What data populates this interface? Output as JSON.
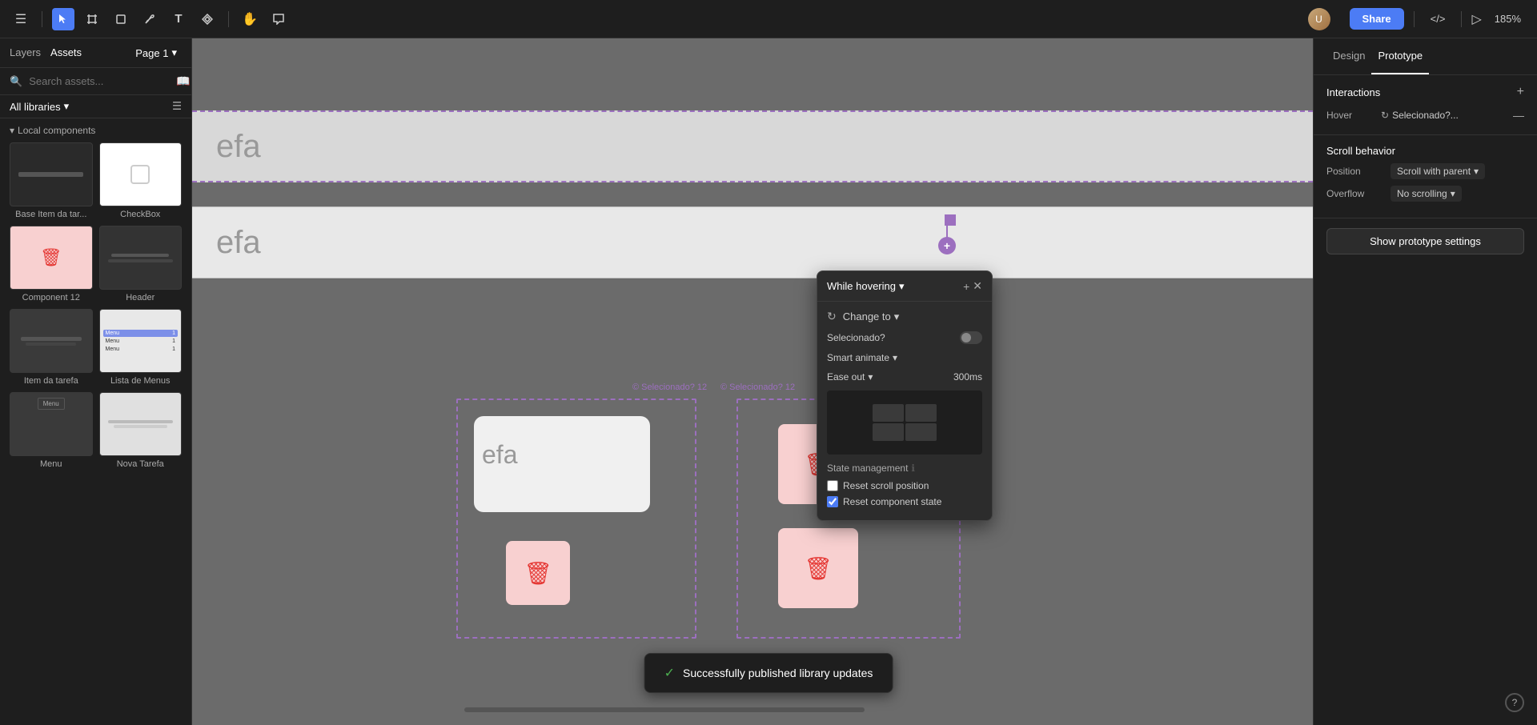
{
  "toolbar": {
    "tools": [
      {
        "name": "menu-icon",
        "icon": "☰",
        "active": false
      },
      {
        "name": "cursor-tool",
        "icon": "↖",
        "active": true
      },
      {
        "name": "frame-tool",
        "icon": "⬜",
        "active": false
      },
      {
        "name": "shape-tool",
        "icon": "◯",
        "active": false
      },
      {
        "name": "pen-tool",
        "icon": "✏",
        "active": false
      },
      {
        "name": "text-tool",
        "icon": "T",
        "active": false
      },
      {
        "name": "component-tool",
        "icon": "❖",
        "active": false
      },
      {
        "name": "hand-tool",
        "icon": "✋",
        "active": false
      },
      {
        "name": "comment-tool",
        "icon": "💬",
        "active": false
      }
    ],
    "share_label": "Share",
    "zoom_level": "185%",
    "code_view": "</>",
    "play_icon": "▷"
  },
  "left_panel": {
    "tabs": [
      {
        "label": "Layers",
        "active": false
      },
      {
        "label": "Assets",
        "active": true
      }
    ],
    "page_selector": "Page 1",
    "search_placeholder": "Search assets...",
    "libraries_label": "All libraries",
    "local_components_label": "Local components",
    "components": [
      {
        "label": "Base Item da tar...",
        "type": "dark-item"
      },
      {
        "label": "CheckBox",
        "type": "checkbox"
      },
      {
        "label": "Component 12",
        "type": "red-trash"
      },
      {
        "label": "Header",
        "type": "header"
      },
      {
        "label": "Item da tarefa",
        "type": "list-item"
      },
      {
        "label": "Lista de Menus",
        "type": "menu-list"
      },
      {
        "label": "Menu",
        "type": "menu-dark"
      },
      {
        "label": "Nova Tarefa",
        "type": "nova-tarefa"
      }
    ]
  },
  "right_panel": {
    "tabs": [
      {
        "label": "Design",
        "active": false
      },
      {
        "label": "Prototype",
        "active": true
      }
    ],
    "interactions_label": "Interactions",
    "add_label": "+",
    "interaction": {
      "trigger": "Hover",
      "action": "Selecionado?...",
      "icon": "↻"
    },
    "scroll_behavior_label": "Scroll behavior",
    "position_label": "Position",
    "position_value": "Scroll with parent",
    "overflow_label": "Overflow",
    "overflow_value": "No scrolling",
    "prototype_settings_label": "Show prototype settings"
  },
  "hover_popup": {
    "title": "While hovering",
    "chevron": "▾",
    "add_icon": "+",
    "close_icon": "✕",
    "change_to_label": "Change to",
    "change_to_icon": "↻",
    "toggle_label": "Selecionado?",
    "toggle_state": "off",
    "smart_animate_label": "Smart animate",
    "smart_animate_chevron": "▾",
    "ease_label": "Ease out",
    "ease_chevron": "▾",
    "ease_time": "300ms",
    "state_management_label": "State management",
    "reset_scroll_label": "Reset scroll position",
    "reset_scroll_checked": false,
    "reset_component_label": "Reset component state",
    "reset_component_checked": true
  },
  "toast": {
    "check_icon": "✓",
    "message": "Successfully published library updates"
  },
  "canvas": {
    "text1": "efa",
    "text2": "efa",
    "text3": "efa",
    "label1": "© Selecionado? 12",
    "label2": "© Selecionado? 12"
  }
}
